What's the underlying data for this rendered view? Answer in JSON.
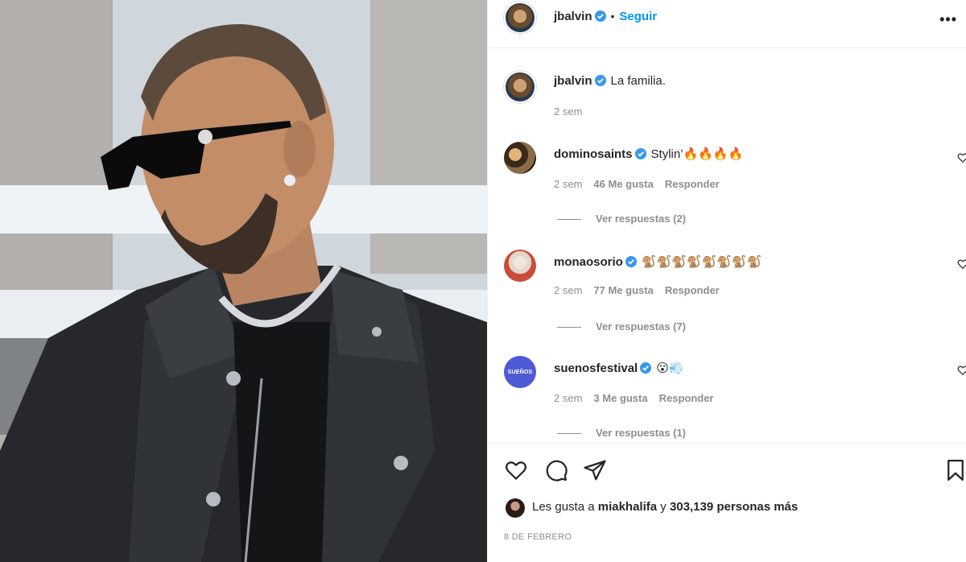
{
  "post": {
    "author": "jbalvin",
    "follow_label": "Seguir",
    "caption": "La familia.",
    "caption_time": "2 sem"
  },
  "comments": [
    {
      "user": "dominosaints",
      "text": "Stylin’🔥🔥🔥🔥",
      "time": "2 sem",
      "likes": "46 Me gusta",
      "reply": "Responder",
      "view_replies": "Ver respuestas (2)"
    },
    {
      "user": "monaosorio",
      "text": "🐒🐒🐒🐒🐒🐒🐒🐒",
      "time": "2 sem",
      "likes": "77 Me gusta",
      "reply": "Responder",
      "view_replies": "Ver respuestas (7)"
    },
    {
      "user": "suenosfestival",
      "text": "😮💨",
      "time": "2 sem",
      "likes": "3 Me gusta",
      "reply": "Responder",
      "view_replies": "Ver respuestas (1)"
    }
  ],
  "likes_line": {
    "prefix": "Les gusta a",
    "user": "miakhalifa",
    "connector": "y",
    "count": "303,139 personas más"
  },
  "date": "8 DE FEBRERO",
  "suenos_avatar_text": "SUEÑOS",
  "colors": {
    "accent": "#0095f6",
    "muted": "#8e8e8e",
    "text": "#262626"
  },
  "icons": [
    "verified-badge-icon",
    "more-options-icon",
    "heart-icon",
    "comment-icon",
    "share-icon",
    "bookmark-icon"
  ]
}
